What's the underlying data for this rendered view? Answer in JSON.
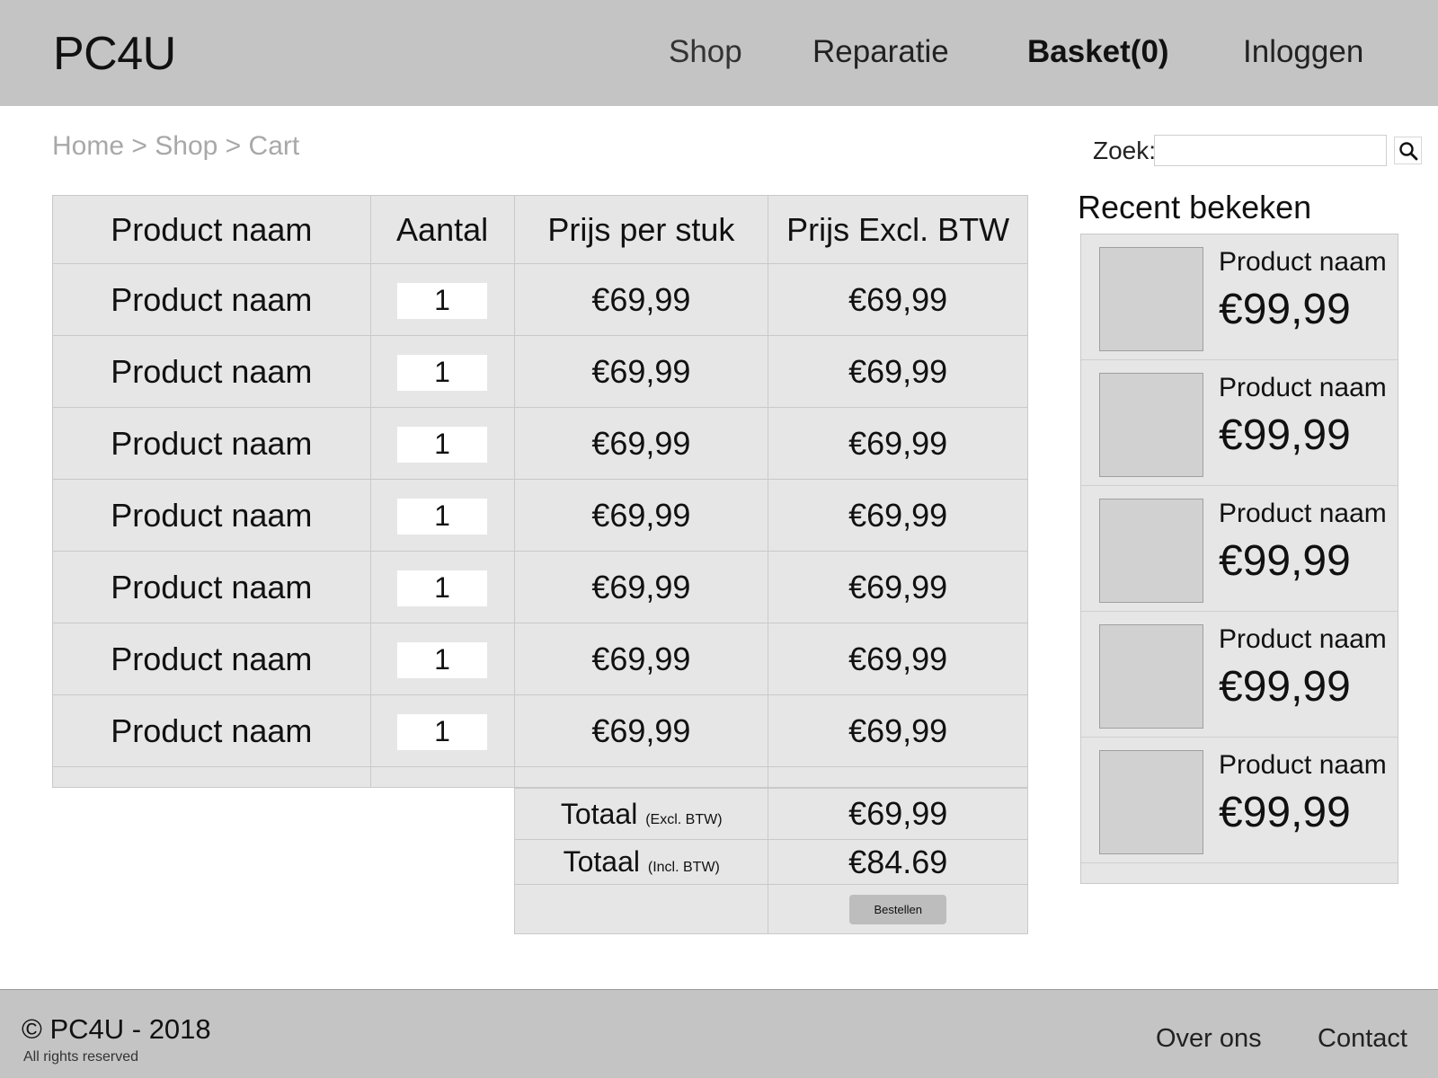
{
  "header": {
    "logo": "PC4U",
    "nav": {
      "shop": "Shop",
      "reparatie": "Reparatie",
      "basket": "Basket(0)",
      "login": "Inloggen"
    }
  },
  "breadcrumb": [
    "Home",
    "Shop",
    "Cart"
  ],
  "breadcrumb_separator": ">",
  "search": {
    "label": "Zoek:",
    "value": "",
    "placeholder": "",
    "icon": "search-icon"
  },
  "cart": {
    "columns": [
      "Product naam",
      "Aantal",
      "Prijs per stuk",
      "Prijs Excl. BTW"
    ],
    "rows": [
      {
        "name": "Product naam",
        "quantity": "1",
        "unit_price": "€69,99",
        "price_excl": "€69,99"
      },
      {
        "name": "Product naam",
        "quantity": "1",
        "unit_price": "€69,99",
        "price_excl": "€69,99"
      },
      {
        "name": "Product naam",
        "quantity": "1",
        "unit_price": "€69,99",
        "price_excl": "€69,99"
      },
      {
        "name": "Product naam",
        "quantity": "1",
        "unit_price": "€69,99",
        "price_excl": "€69,99"
      },
      {
        "name": "Product naam",
        "quantity": "1",
        "unit_price": "€69,99",
        "price_excl": "€69,99"
      },
      {
        "name": "Product naam",
        "quantity": "1",
        "unit_price": "€69,99",
        "price_excl": "€69,99"
      },
      {
        "name": "Product naam",
        "quantity": "1",
        "unit_price": "€69,99",
        "price_excl": "€69,99"
      }
    ],
    "totals": {
      "excl_label": "Totaal",
      "excl_note": "(Excl. BTW)",
      "excl_value": "€69,99",
      "incl_label": "Totaal",
      "incl_note": "(Incl. BTW)",
      "incl_value": "€84.69",
      "order_button": "Bestellen"
    }
  },
  "recent": {
    "title": "Recent bekeken",
    "items": [
      {
        "name": "Product naam",
        "price": "€99,99"
      },
      {
        "name": "Product naam",
        "price": "€99,99"
      },
      {
        "name": "Product naam",
        "price": "€99,99"
      },
      {
        "name": "Product naam",
        "price": "€99,99"
      },
      {
        "name": "Product naam",
        "price": "€99,99"
      }
    ]
  },
  "footer": {
    "copyright": "© PC4U - 2018",
    "rights": "All rights reserved",
    "links": {
      "about": "Over ons",
      "contact": "Contact"
    }
  }
}
